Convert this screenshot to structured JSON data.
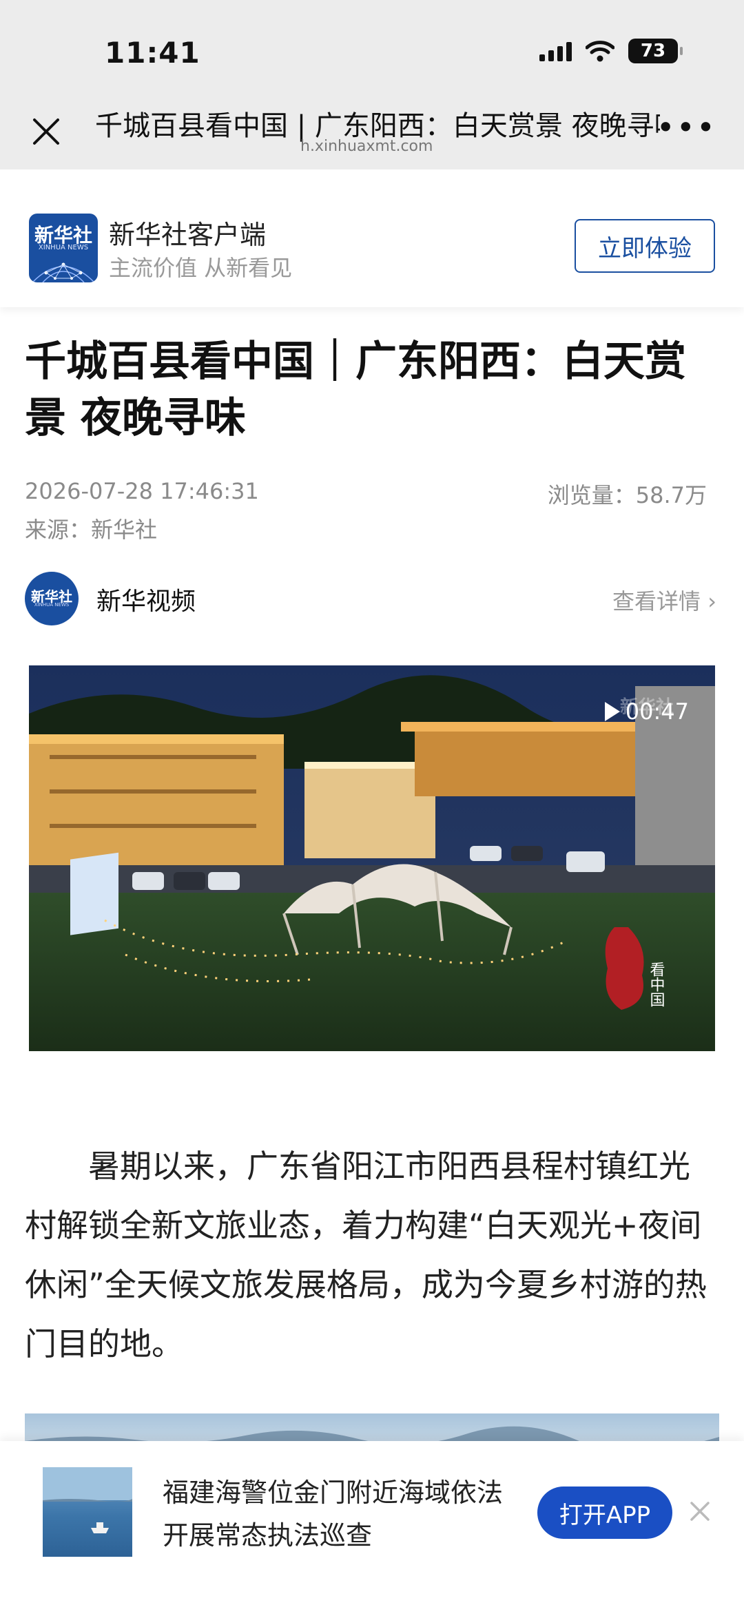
{
  "status_bar": {
    "time": "11:41",
    "battery": "73"
  },
  "browser": {
    "title": "千城百县看中国 | 广东阳西：白天赏景 夜晚寻味",
    "url": "h.xinhuaxmt.com",
    "more": "•••"
  },
  "promo": {
    "logo_text": "新华社",
    "logo_sub": "XINHUA NEWS",
    "app_name": "新华社客户端",
    "slogan": "主流价值 从新看见",
    "button": "立即体验"
  },
  "article": {
    "headline": "千城百县看中国｜广东阳西：白天赏景 夜晚寻味",
    "datetime": "2026-07-28 17:46:31",
    "views": "浏览量：58.7万",
    "source": "来源：新华社",
    "author": {
      "avatar_text": "新华社",
      "avatar_sub": "XINHUA NEWS",
      "name": "新华视频",
      "more": "查看详情 ›"
    },
    "video": {
      "duration": "00:47",
      "watermark": "新华社",
      "seal_text": "看中国"
    },
    "paragraph": "暑期以来，广东省阳江市阳西县程村镇红光村解锁全新文旅业态，着力构建“白天观光+夜间休闲”全天候文旅发展格局，成为今夏乡村游的热门目的地。"
  },
  "banner": {
    "text": "福建海警位金门附近海域依法开展常态执法巡查",
    "button": "打开APP"
  }
}
